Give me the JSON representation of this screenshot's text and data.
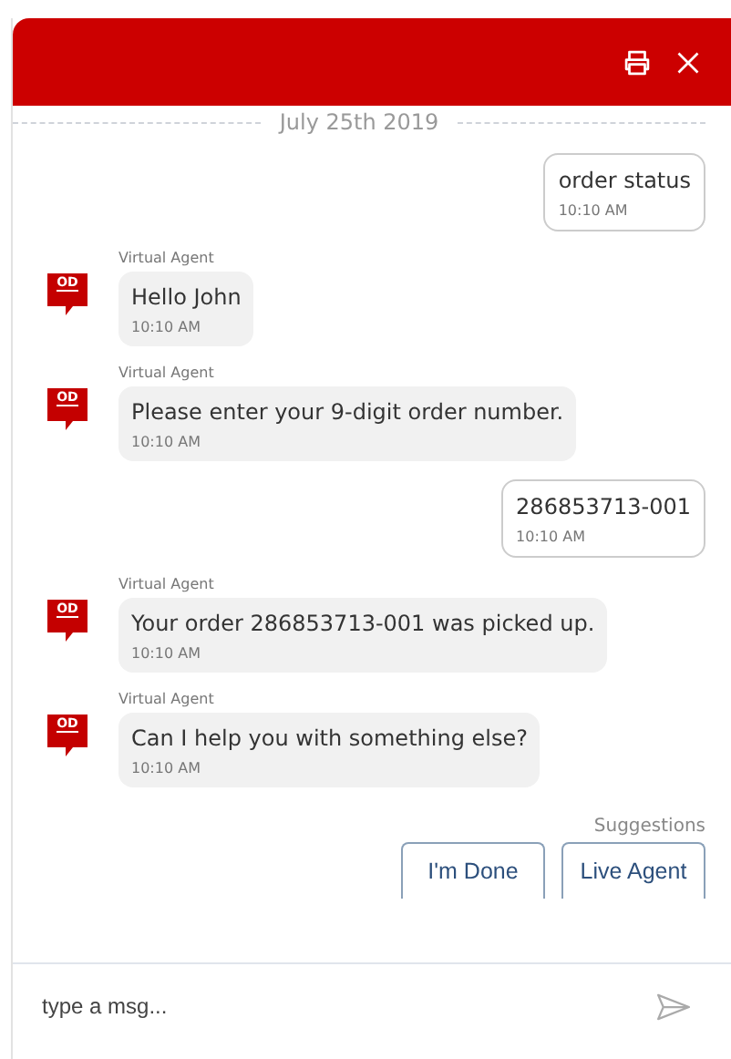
{
  "header": {
    "buttons": [
      {
        "kind": "print"
      },
      {
        "kind": "close"
      }
    ]
  },
  "date": "July 25th 2019",
  "messages": [
    {
      "kind": "user",
      "text": "order status",
      "time": "10:10 AM"
    },
    {
      "kind": "agent",
      "sender": "Virtual Agent",
      "avatar": "OD",
      "text": "Hello John",
      "time": "10:10 AM"
    },
    {
      "kind": "agent",
      "sender": "Virtual Agent",
      "avatar": "OD",
      "text": "Please enter your 9-digit order number.",
      "time": "10:10 AM"
    },
    {
      "kind": "user",
      "text": "286853713-001",
      "time": "10:10 AM"
    },
    {
      "kind": "agent",
      "sender": "Virtual Agent",
      "avatar": "OD",
      "text": "Your order 286853713-001 was picked up.",
      "time": "10:10 AM"
    },
    {
      "kind": "agent",
      "sender": "Virtual Agent",
      "avatar": "OD",
      "text": "Can I help you with something else?",
      "time": "10:10 AM"
    }
  ],
  "suggestions": {
    "label": "Suggestions",
    "buttons": [
      "I'm Done",
      "Live Agent"
    ]
  },
  "composer": {
    "placeholder": "type a msg..."
  }
}
